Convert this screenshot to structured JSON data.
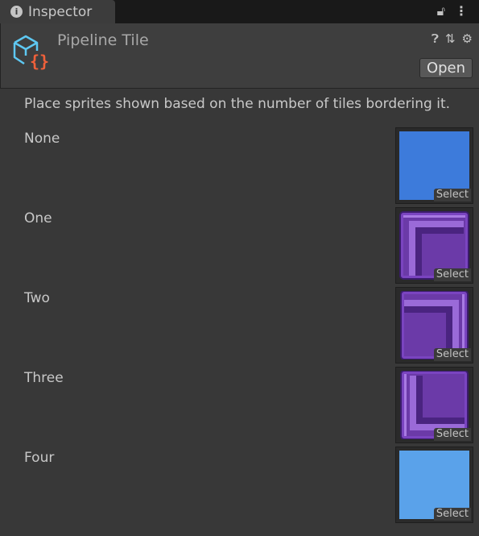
{
  "tab": {
    "label": "Inspector",
    "icon": "info-icon"
  },
  "tab_icons": [
    "lock-icon",
    "kebab-menu-icon"
  ],
  "header": {
    "title": "Pipeline Tile",
    "icon": "script-asset-icon",
    "icons": [
      "help-icon",
      "preset-icon",
      "gear-icon"
    ],
    "open_label": "Open"
  },
  "description": "Place sprites shown based on the number of tiles bordering it.",
  "rows": [
    {
      "label": "None",
      "sprite": "solid",
      "color": "#3d7bdb",
      "corner": "",
      "select": "Select"
    },
    {
      "label": "One",
      "sprite": "bevel",
      "color": "#6b3aa8",
      "corner": "top-left",
      "select": "Select"
    },
    {
      "label": "Two",
      "sprite": "bevel",
      "color": "#6b3aa8",
      "corner": "top-right",
      "select": "Select"
    },
    {
      "label": "Three",
      "sprite": "bevel",
      "color": "#6b3aa8",
      "corner": "bottom-left",
      "select": "Select"
    },
    {
      "label": "Four",
      "sprite": "solid",
      "color": "#5aa2ea",
      "corner": "",
      "select": "Select"
    }
  ]
}
